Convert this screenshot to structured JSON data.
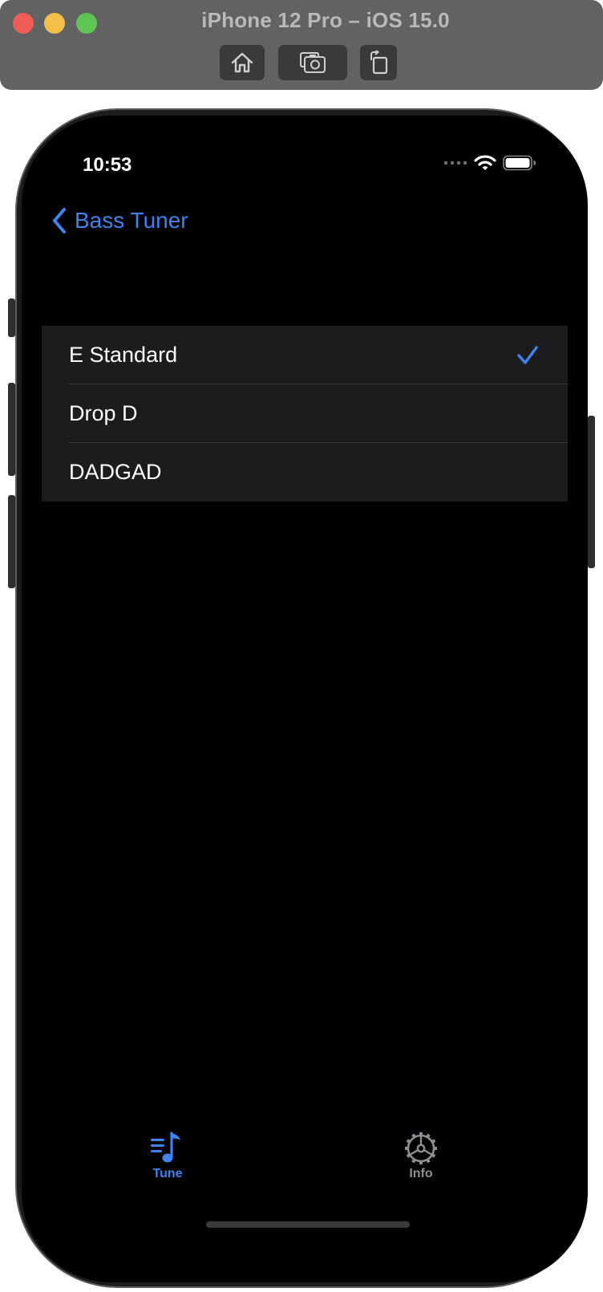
{
  "simulator": {
    "title": "iPhone 12 Pro – iOS 15.0",
    "toolbar": {
      "home_icon": "home-icon",
      "screenshot_icon": "camera-icon",
      "rotate_icon": "rotate-icon"
    }
  },
  "status_bar": {
    "time": "10:53",
    "icons": [
      "signal-dots-icon",
      "wifi-icon",
      "battery-icon"
    ]
  },
  "nav": {
    "back_label": "Bass Tuner",
    "back_icon": "chevron-left-icon"
  },
  "tunings": [
    {
      "label": "E Standard",
      "selected": true
    },
    {
      "label": "Drop D",
      "selected": false
    },
    {
      "label": "DADGAD",
      "selected": false
    }
  ],
  "tab_bar": {
    "items": [
      {
        "label": "Tune",
        "icon": "music-list-icon",
        "active": true
      },
      {
        "label": "Info",
        "icon": "gear-icon",
        "active": false
      }
    ]
  },
  "colors": {
    "accent": "#3f83f2",
    "background": "#000000",
    "cell": "#1c1c1e",
    "inactive_tab": "#8e8e93"
  }
}
